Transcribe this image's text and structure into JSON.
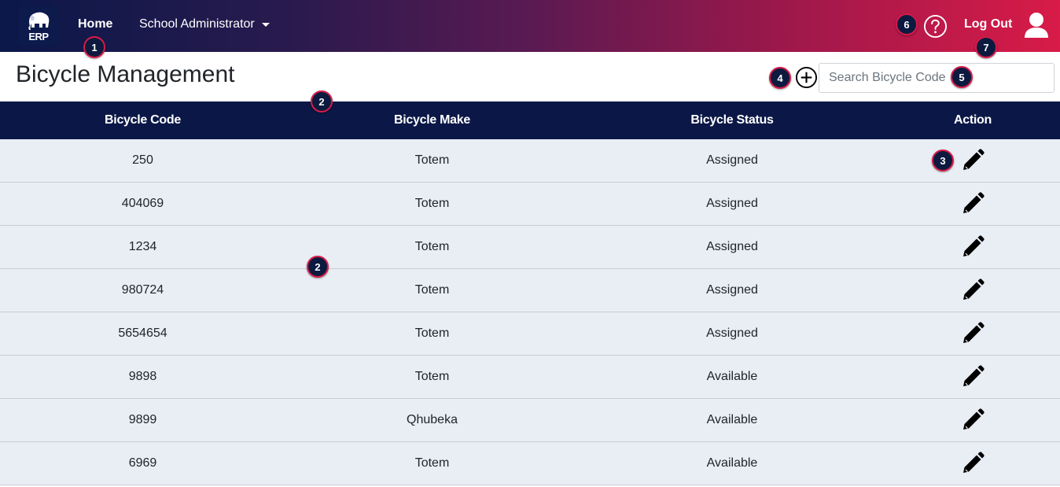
{
  "app": {
    "logo_text": "ERP"
  },
  "nav": {
    "home": "Home",
    "admin_menu": "School Administrator",
    "logout": "Log Out"
  },
  "header": {
    "title": "Bicycle Management",
    "search_placeholder": "Search Bicycle Code"
  },
  "table": {
    "columns": [
      "Bicycle Code",
      "Bicycle Make",
      "Bicycle Status",
      "Action"
    ],
    "rows": [
      {
        "code": "250",
        "make": "Totem",
        "status": "Assigned"
      },
      {
        "code": "404069",
        "make": "Totem",
        "status": "Assigned"
      },
      {
        "code": "1234",
        "make": "Totem",
        "status": "Assigned"
      },
      {
        "code": "980724",
        "make": "Totem",
        "status": "Assigned"
      },
      {
        "code": "5654654",
        "make": "Totem",
        "status": "Assigned"
      },
      {
        "code": "9898",
        "make": "Totem",
        "status": "Available"
      },
      {
        "code": "9899",
        "make": "Qhubeka",
        "status": "Available"
      },
      {
        "code": "6969",
        "make": "Totem",
        "status": "Available"
      }
    ]
  },
  "badges": {
    "b1": "1",
    "b2a": "2",
    "b2b": "2",
    "b3": "3",
    "b4": "4",
    "b5": "5",
    "b6": "6",
    "b7": "7"
  },
  "icons": {
    "logo": "elephant-icon",
    "menu_caret": "caret-down-icon",
    "help": "question-circle-icon",
    "user": "user-icon",
    "add": "plus-circle-icon",
    "edit": "pencil-icon"
  },
  "colors": {
    "navbar_start": "#0b1849",
    "navbar_end": "#d81b48",
    "table_header": "#0b1847",
    "row_bg": "#e9edf4",
    "badge_bg": "#0c1a40",
    "badge_border": "#d81b48"
  }
}
